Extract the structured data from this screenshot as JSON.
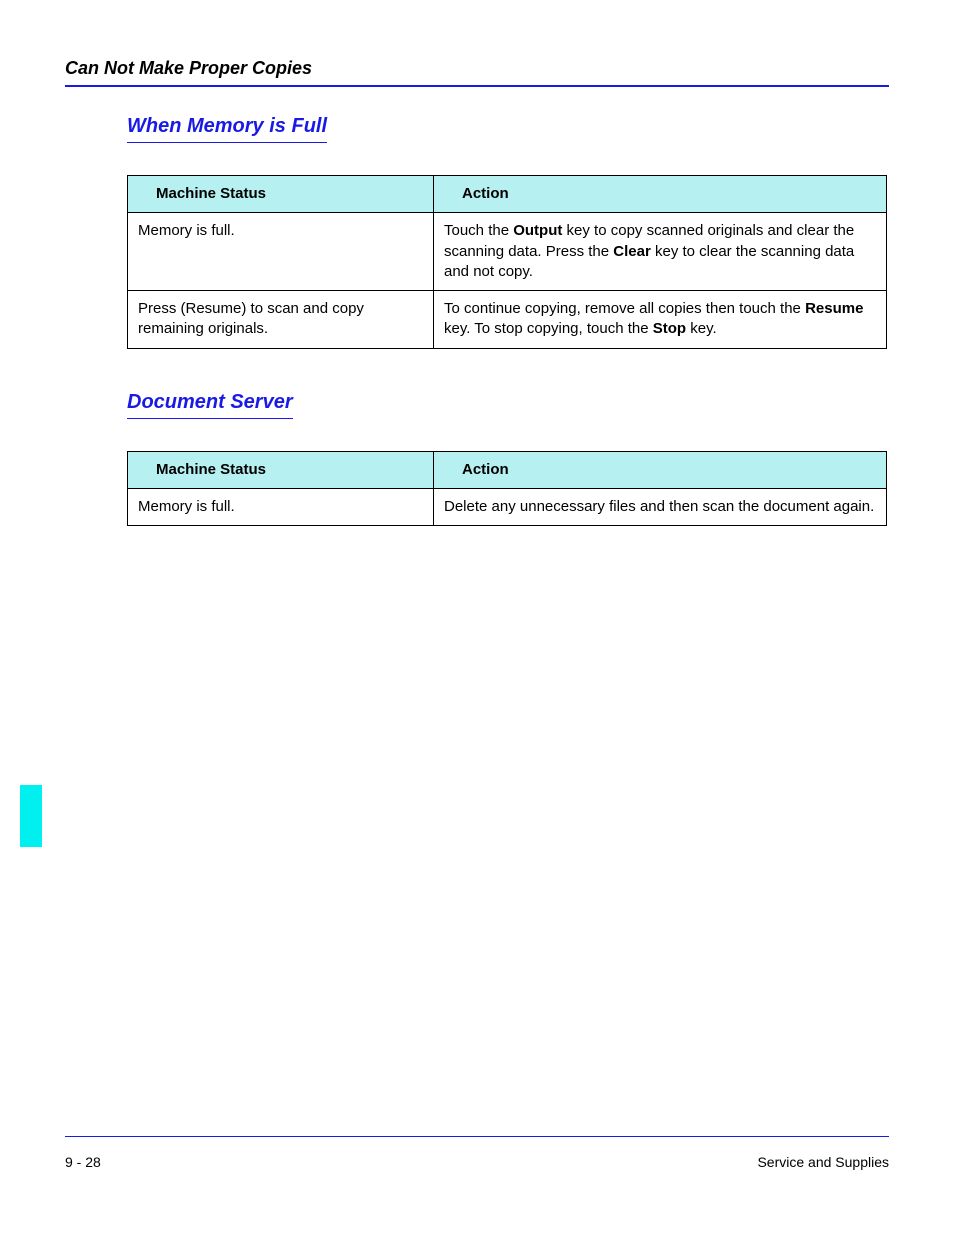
{
  "header": {
    "title": "Can Not Make Proper Copies"
  },
  "sections": {
    "memory": {
      "heading": "When Memory is Full",
      "columns": {
        "status": "Machine Status",
        "action": "Action"
      },
      "rows": [
        {
          "status": "Memory is full.",
          "action_pre": "Touch the ",
          "action_b1": "Output",
          "action_mid": " key to copy scanned originals and clear the scanning data. Press the ",
          "action_b2": "Clear",
          "action_post": " key to clear the scanning data and not copy."
        },
        {
          "status": "Press (Resume) to scan and copy remaining originals.",
          "action_pre": "To continue copying, remove all copies then touch the ",
          "action_b1": "Resume",
          "action_mid": " key. To stop copying, touch the ",
          "action_b2": "Stop",
          "action_post": " key."
        }
      ]
    },
    "docserver": {
      "heading": "Document Server",
      "columns": {
        "status": "Machine Status",
        "action": "Action"
      },
      "rows": [
        {
          "status": "Memory is full.",
          "action": "Delete any unnecessary files and then scan the document again."
        }
      ]
    }
  },
  "footer": {
    "page": "9 - 28",
    "section": "Service and Supplies"
  }
}
